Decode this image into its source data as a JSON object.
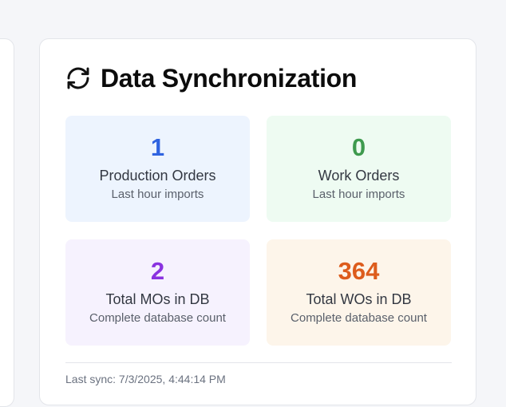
{
  "panel": {
    "title": "Data Synchronization",
    "icon": "refresh-icon"
  },
  "stats": [
    {
      "value": "1",
      "label": "Production Orders",
      "sub": "Last hour imports",
      "color": "#2f63e0"
    },
    {
      "value": "0",
      "label": "Work Orders",
      "sub": "Last hour imports",
      "color": "#3e9a4e"
    },
    {
      "value": "2",
      "label": "Total MOs in DB",
      "sub": "Complete database count",
      "color": "#8a33e0"
    },
    {
      "value": "364",
      "label": "Total WOs in DB",
      "sub": "Complete database count",
      "color": "#dd5c1c"
    }
  ],
  "footer": {
    "last_sync": "Last sync: 7/3/2025, 4:44:14 PM"
  }
}
